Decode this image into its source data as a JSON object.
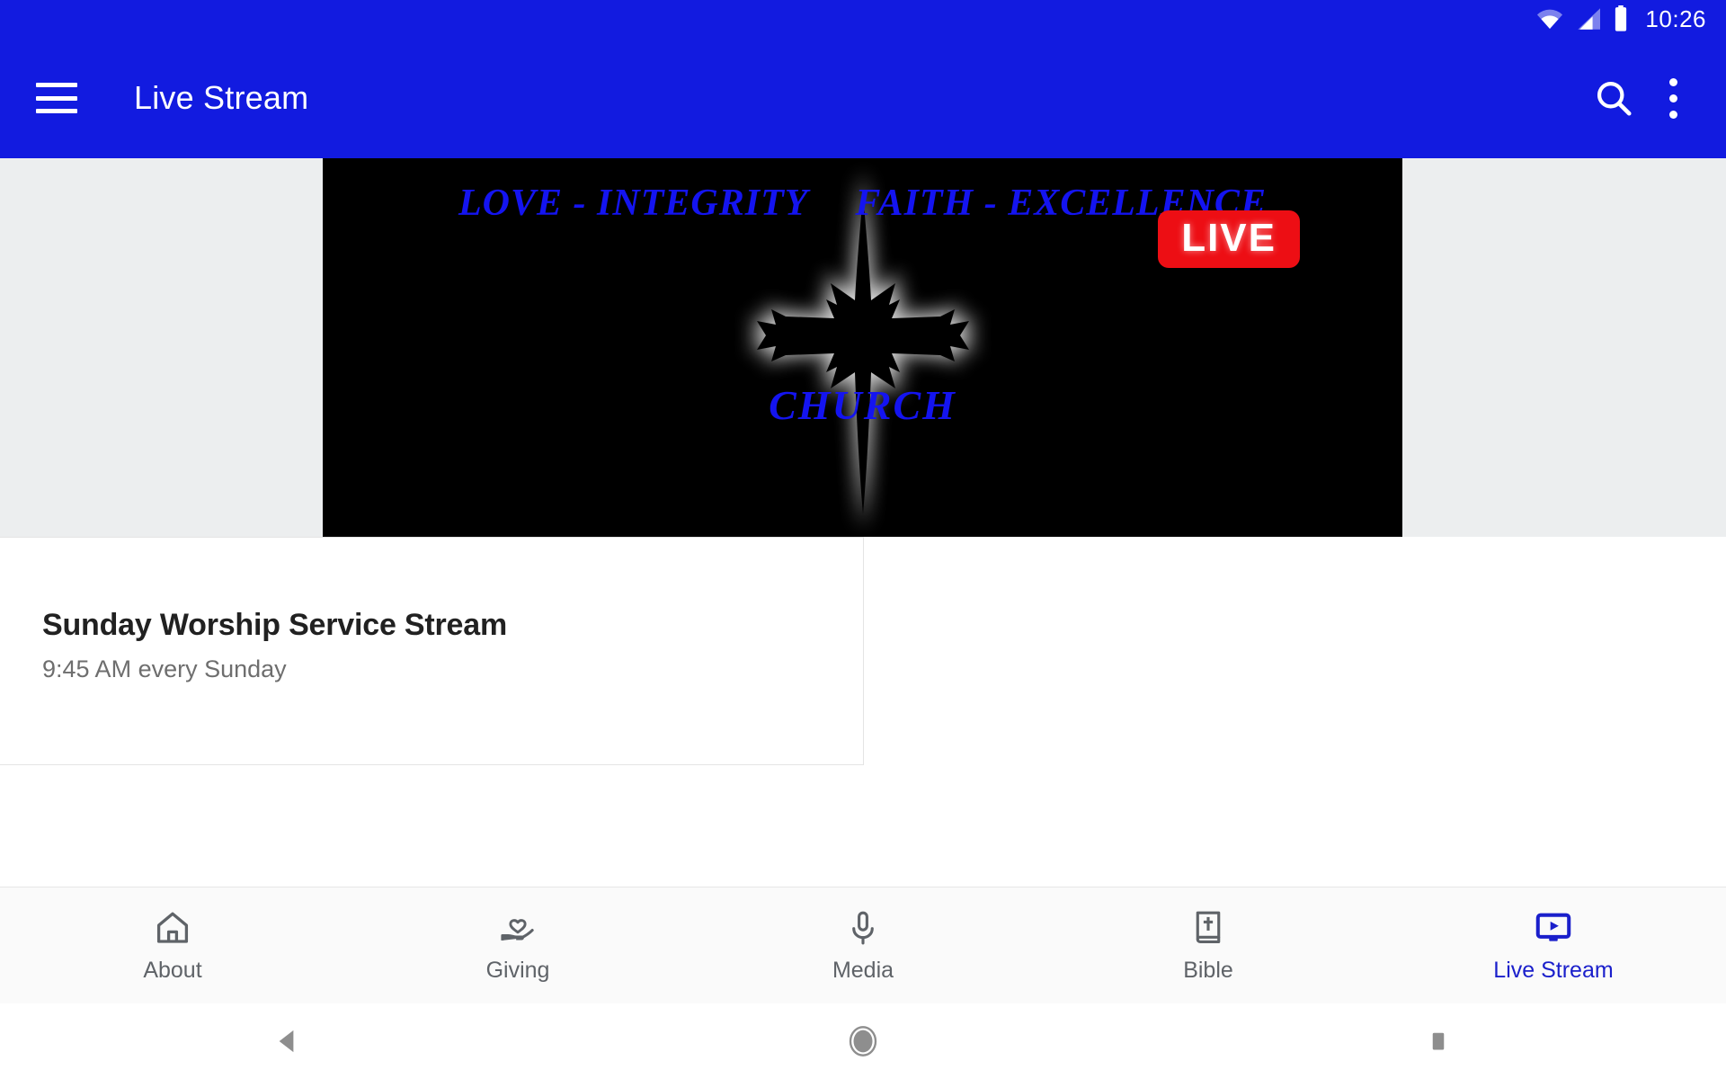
{
  "status_bar": {
    "clock": "10:26",
    "icons": [
      "wifi-icon",
      "cell-signal-icon",
      "battery-icon"
    ],
    "background": "#121BE0"
  },
  "app_bar": {
    "title": "Live Stream",
    "menu_icon": "hamburger-menu-icon",
    "search_icon": "search-icon",
    "overflow_icon": "overflow-menu-icon",
    "background": "#121BE0",
    "foreground": "#FFFFFF"
  },
  "player": {
    "background": "#ECEEEF",
    "banner_background": "#000000",
    "tagline_left": "LOVE - INTEGRITY",
    "tagline_right": "FAITH - EXCELLENCE",
    "church_word": "CHURCH",
    "brand_color": "#1414F0",
    "live_badge": {
      "label": "LIVE",
      "background": "#ED0E14",
      "color": "#FFFFFF"
    },
    "logo_icon": "glowing-cross-icon"
  },
  "stream_card": {
    "title": "Sunday Worship Service Stream",
    "subtitle": "9:45 AM every Sunday"
  },
  "bottom_nav": {
    "active_color": "#1A1FCB",
    "inactive_color": "#5F6368",
    "items": [
      {
        "label": "About",
        "icon": "home-icon",
        "active": false
      },
      {
        "label": "Giving",
        "icon": "hand-heart-icon",
        "active": false
      },
      {
        "label": "Media",
        "icon": "microphone-icon",
        "active": false
      },
      {
        "label": "Bible",
        "icon": "bible-book-icon",
        "active": false
      },
      {
        "label": "Live Stream",
        "icon": "live-monitor-icon",
        "active": true
      }
    ]
  },
  "system_nav": {
    "buttons": [
      {
        "name": "back-button",
        "icon": "triangle-back-icon"
      },
      {
        "name": "home-button",
        "icon": "circle-home-icon"
      },
      {
        "name": "recents-button",
        "icon": "square-recents-icon"
      }
    ]
  }
}
